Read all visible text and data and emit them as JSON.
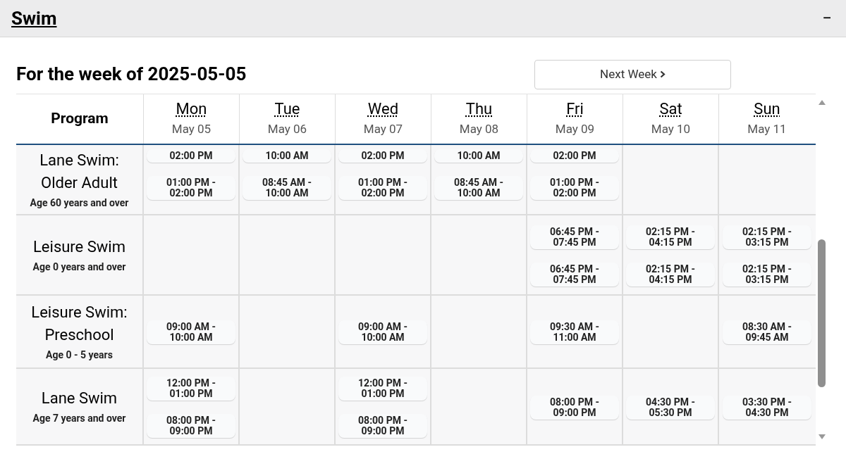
{
  "panel": {
    "title": "Swim",
    "collapse_icon": "−"
  },
  "heading": "For the week of 2025-05-05",
  "next_button": {
    "label": "Next Week"
  },
  "table": {
    "program_header": "Program",
    "days": [
      {
        "day": "Mon",
        "date": "May 05"
      },
      {
        "day": "Tue",
        "date": "May 06"
      },
      {
        "day": "Wed",
        "date": "May 07"
      },
      {
        "day": "Thu",
        "date": "May 08"
      },
      {
        "day": "Fri",
        "date": "May 09"
      },
      {
        "day": "Sat",
        "date": "May 10"
      },
      {
        "day": "Sun",
        "date": "May 11"
      }
    ],
    "rows": [
      {
        "name": "Lane Swim: Older Adult",
        "age": "Age 60 years and over",
        "cells": [
          {
            "kind": "sessions",
            "times": [
              "02:00 PM",
              "01:00 PM - 02:00 PM"
            ]
          },
          {
            "kind": "sessions",
            "times": [
              "10:00 AM",
              "08:45 AM - 10:00 AM"
            ]
          },
          {
            "kind": "sessions",
            "times": [
              "02:00 PM",
              "01:00 PM - 02:00 PM"
            ]
          },
          {
            "kind": "sessions",
            "times": [
              "10:00 AM",
              "08:45 AM - 10:00 AM"
            ]
          },
          {
            "kind": "sessions",
            "times": [
              "02:00 PM",
              "01:00 PM - 02:00 PM"
            ]
          },
          {
            "kind": "empty"
          },
          {
            "kind": "empty"
          }
        ]
      },
      {
        "name": "Leisure Swim",
        "age": "Age 0 years and over",
        "cells": [
          {
            "kind": "empty"
          },
          {
            "kind": "empty"
          },
          {
            "kind": "empty"
          },
          {
            "kind": "empty"
          },
          {
            "kind": "sessions",
            "times": [
              "06:45 PM - 07:45 PM",
              "06:45 PM - 07:45 PM"
            ]
          },
          {
            "kind": "sessions",
            "times": [
              "02:15 PM - 04:15 PM",
              "02:15 PM - 04:15 PM"
            ]
          },
          {
            "kind": "sessions",
            "times": [
              "02:15 PM - 03:15 PM",
              "02:15 PM - 03:15 PM"
            ]
          }
        ]
      },
      {
        "name": "Leisure Swim: Preschool",
        "age": "Age 0 - 5 years",
        "cells": [
          {
            "kind": "sessions",
            "times": [
              "09:00 AM - 10:00 AM"
            ]
          },
          {
            "kind": "empty"
          },
          {
            "kind": "sessions",
            "times": [
              "09:00 AM - 10:00 AM"
            ]
          },
          {
            "kind": "empty"
          },
          {
            "kind": "sessions",
            "times": [
              "09:30 AM - 11:00 AM"
            ]
          },
          {
            "kind": "empty"
          },
          {
            "kind": "sessions",
            "times": [
              "08:30 AM - 09:45 AM"
            ]
          }
        ]
      },
      {
        "name": "Lane Swim",
        "age": "Age 7 years and over",
        "cells": [
          {
            "kind": "sessions",
            "times": [
              "12:00 PM - 01:00 PM",
              "08:00 PM - 09:00 PM"
            ]
          },
          {
            "kind": "empty"
          },
          {
            "kind": "sessions",
            "times": [
              "12:00 PM - 01:00 PM",
              "08:00 PM - 09:00 PM"
            ]
          },
          {
            "kind": "empty"
          },
          {
            "kind": "sessions",
            "times": [
              "08:00 PM - 09:00 PM"
            ]
          },
          {
            "kind": "sessions",
            "times": [
              "04:30 PM - 05:30 PM"
            ]
          },
          {
            "kind": "sessions",
            "times": [
              "03:30 PM - 04:30 PM"
            ]
          }
        ]
      }
    ]
  }
}
